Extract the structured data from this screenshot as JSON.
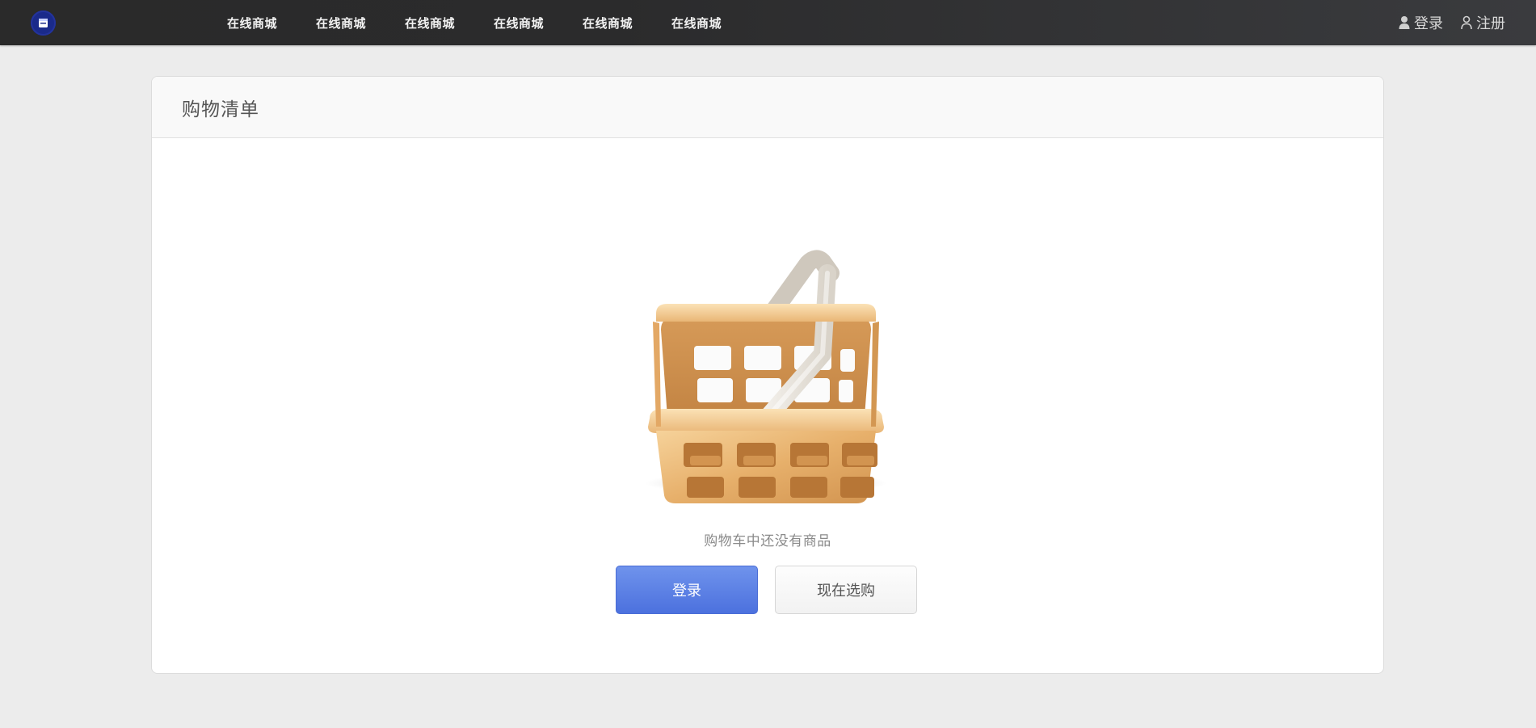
{
  "nav": {
    "items": [
      {
        "label": "在线商城"
      },
      {
        "label": "在线商城"
      },
      {
        "label": "在线商城"
      },
      {
        "label": "在线商城"
      },
      {
        "label": "在线商城"
      },
      {
        "label": "在线商城"
      }
    ]
  },
  "user_menu": {
    "login_label": "登录",
    "register_label": "注册"
  },
  "cart": {
    "title": "购物清单",
    "empty_message": "购物车中还没有商品",
    "login_button": "登录",
    "shop_button": "现在选购"
  },
  "icons": {
    "logo": "store-icon",
    "login": "user-filled-icon",
    "register": "user-outline-icon",
    "empty_cart": "basket-icon"
  },
  "colors": {
    "topbar": "#2b2b2c",
    "primary_button": "#5b80e6",
    "logo_bg": "#1a2a8a",
    "page_bg": "#ececec"
  }
}
